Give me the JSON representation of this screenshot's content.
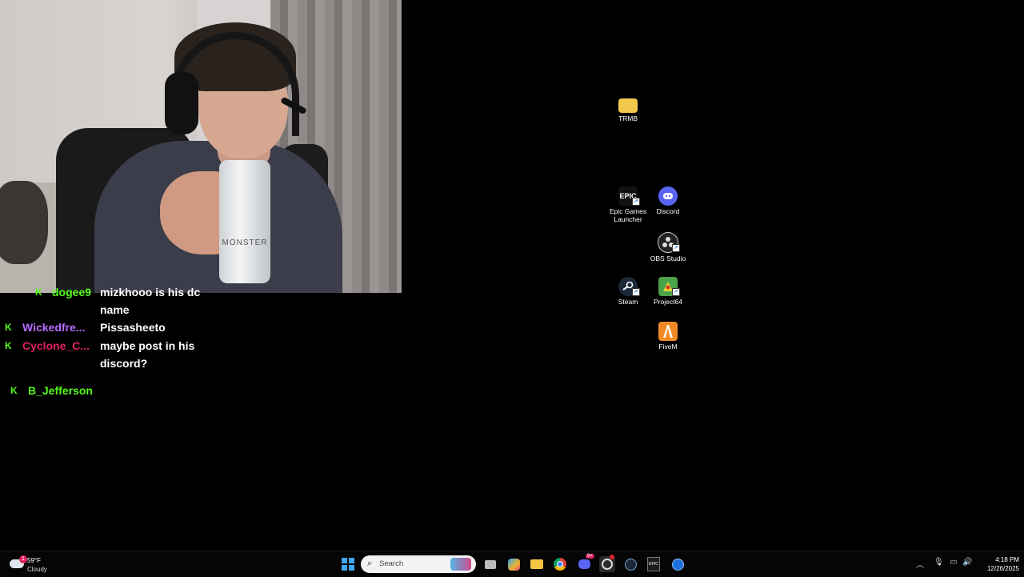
{
  "webcam": {
    "can_text": "MONSTER"
  },
  "chat": {
    "messages": [
      {
        "user": "dogee9",
        "user_color": "#53fc18",
        "text": "mizkhooo is his dc name"
      },
      {
        "user": "Wickedfre...",
        "user_color": "#b76cff",
        "text": "Pissasheeto"
      },
      {
        "user": "Cyclone_C...",
        "user_color": "#e0245e",
        "text": "maybe post in his discord?"
      },
      {
        "user": "B_Jefferson",
        "user_color": "#53fc18",
        "text": ""
      }
    ]
  },
  "desktop": {
    "icons": [
      {
        "label": "TRMB",
        "icon": "folder-icon"
      },
      {
        "label": "Epic Games Launcher",
        "icon": "epic-games-icon",
        "glyph": "EPIC"
      },
      {
        "label": "Discord",
        "icon": "discord-icon"
      },
      {
        "label": "OBS Studio",
        "icon": "obs-icon"
      },
      {
        "label": "Steam",
        "icon": "steam-icon"
      },
      {
        "label": "Project64",
        "icon": "project64-icon"
      },
      {
        "label": "FiveM",
        "icon": "fivem-icon"
      }
    ]
  },
  "taskbar": {
    "weather": {
      "temp": "59°F",
      "condition": "Cloudy",
      "badge": "1"
    },
    "search_placeholder": "Search",
    "apps": [
      "task-view-icon",
      "copilot-icon",
      "file-explorer-icon",
      "chrome-icon",
      "discord-icon",
      "obs-icon",
      "steam-icon",
      "epic-games-icon",
      "edge-dev-icon"
    ],
    "discord_badge": "9+",
    "epic_glyph": "EPIC",
    "clock": {
      "time": "4:18 PM",
      "date": "12/26/2025"
    }
  }
}
